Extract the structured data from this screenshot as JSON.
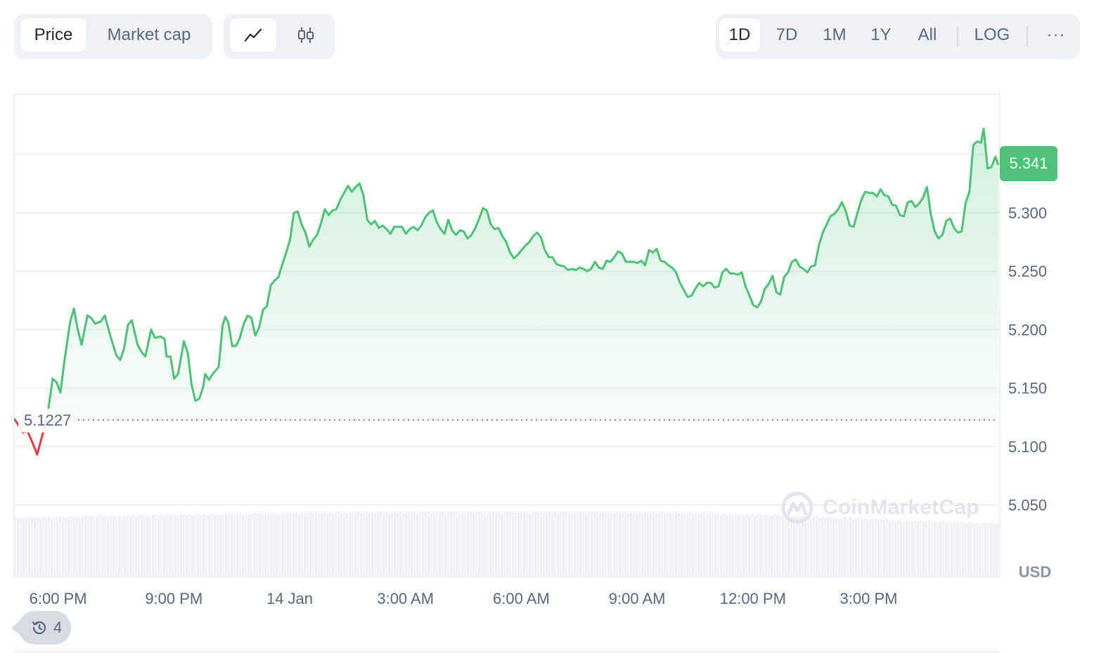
{
  "toolbar": {
    "metric_tabs": [
      "Price",
      "Market cap"
    ],
    "active_metric": "Price",
    "chart_type_icons": [
      "line-chart-icon",
      "candlestick-icon"
    ],
    "active_chart_type": "line-chart-icon",
    "ranges": [
      "1D",
      "7D",
      "1M",
      "1Y",
      "All"
    ],
    "active_range": "1D",
    "log_label": "LOG",
    "more_label": "···"
  },
  "colors": {
    "up": "#4cc276",
    "down": "#ea3943",
    "fill_top": "#d1f0dc",
    "grid": "#eff2f5",
    "volume": "#eff2f5"
  },
  "chart_data": {
    "type": "line",
    "title": "",
    "xlabel": "",
    "ylabel": "",
    "currency": "USD",
    "ylim": [
      5.0,
      5.4
    ],
    "y_ticks": [
      "5.050",
      "5.100",
      "5.150",
      "5.200",
      "5.250",
      "5.300"
    ],
    "x_tick_labels": [
      "6:00 PM",
      "9:00 PM",
      "14 Jan",
      "3:00 AM",
      "6:00 AM",
      "9:00 AM",
      "12:00 PM",
      "3:00 PM"
    ],
    "x_tick_hours": [
      1.14,
      4.14,
      7.14,
      10.14,
      13.14,
      16.14,
      19.14,
      22.14
    ],
    "open_price": 5.1227,
    "current_price": 5.341,
    "current_price_label": "5.341",
    "open_price_label": "5.1227",
    "series": [
      {
        "points": [
          [
            0.0,
            5.124
          ],
          [
            0.1,
            5.119
          ],
          [
            0.22,
            5.112
          ],
          [
            0.35,
            5.113
          ],
          [
            0.48,
            5.103
          ],
          [
            0.6,
            5.093
          ],
          [
            0.72,
            5.108
          ],
          [
            0.85,
            5.123
          ],
          [
            1.0,
            5.158
          ],
          [
            1.1,
            5.155
          ],
          [
            1.2,
            5.146
          ],
          [
            1.3,
            5.172
          ],
          [
            1.45,
            5.206
          ],
          [
            1.55,
            5.218
          ],
          [
            1.65,
            5.2
          ],
          [
            1.75,
            5.187
          ],
          [
            1.9,
            5.212
          ],
          [
            2.0,
            5.21
          ],
          [
            2.1,
            5.205
          ],
          [
            2.25,
            5.207
          ],
          [
            2.35,
            5.212
          ],
          [
            2.5,
            5.194
          ],
          [
            2.65,
            5.178
          ],
          [
            2.75,
            5.174
          ],
          [
            2.85,
            5.184
          ],
          [
            2.95,
            5.204
          ],
          [
            3.05,
            5.208
          ],
          [
            3.2,
            5.187
          ],
          [
            3.3,
            5.181
          ],
          [
            3.4,
            5.177
          ],
          [
            3.55,
            5.2
          ],
          [
            3.65,
            5.193
          ],
          [
            3.8,
            5.194
          ],
          [
            3.9,
            5.192
          ],
          [
            3.95,
            5.177
          ],
          [
            4.05,
            5.177
          ],
          [
            4.15,
            5.158
          ],
          [
            4.25,
            5.162
          ],
          [
            4.4,
            5.19
          ],
          [
            4.5,
            5.18
          ],
          [
            4.6,
            5.153
          ],
          [
            4.7,
            5.139
          ],
          [
            4.8,
            5.141
          ],
          [
            4.9,
            5.151
          ],
          [
            4.95,
            5.162
          ],
          [
            5.05,
            5.157
          ],
          [
            5.15,
            5.162
          ],
          [
            5.3,
            5.168
          ],
          [
            5.4,
            5.203
          ],
          [
            5.47,
            5.211
          ],
          [
            5.55,
            5.206
          ],
          [
            5.65,
            5.186
          ],
          [
            5.75,
            5.186
          ],
          [
            5.85,
            5.193
          ],
          [
            5.95,
            5.205
          ],
          [
            6.05,
            5.212
          ],
          [
            6.15,
            5.21
          ],
          [
            6.25,
            5.195
          ],
          [
            6.35,
            5.202
          ],
          [
            6.45,
            5.217
          ],
          [
            6.55,
            5.22
          ],
          [
            6.65,
            5.238
          ],
          [
            6.75,
            5.242
          ],
          [
            6.85,
            5.245
          ],
          [
            6.95,
            5.256
          ],
          [
            7.05,
            5.266
          ],
          [
            7.15,
            5.277
          ],
          [
            7.25,
            5.3
          ],
          [
            7.35,
            5.301
          ],
          [
            7.45,
            5.29
          ],
          [
            7.55,
            5.283
          ],
          [
            7.65,
            5.271
          ],
          [
            7.75,
            5.277
          ],
          [
            7.85,
            5.281
          ],
          [
            7.95,
            5.291
          ],
          [
            8.05,
            5.303
          ],
          [
            8.15,
            5.298
          ],
          [
            8.25,
            5.302
          ],
          [
            8.35,
            5.303
          ],
          [
            8.45,
            5.311
          ],
          [
            8.55,
            5.317
          ],
          [
            8.65,
            5.323
          ],
          [
            8.75,
            5.318
          ],
          [
            8.85,
            5.322
          ],
          [
            8.95,
            5.325
          ],
          [
            9.05,
            5.315
          ],
          [
            9.15,
            5.294
          ],
          [
            9.25,
            5.29
          ],
          [
            9.35,
            5.293
          ],
          [
            9.45,
            5.287
          ],
          [
            9.55,
            5.289
          ],
          [
            9.65,
            5.286
          ],
          [
            9.75,
            5.282
          ],
          [
            9.85,
            5.288
          ],
          [
            9.95,
            5.288
          ],
          [
            10.05,
            5.288
          ],
          [
            10.15,
            5.282
          ],
          [
            10.25,
            5.286
          ],
          [
            10.35,
            5.288
          ],
          [
            10.45,
            5.285
          ],
          [
            10.55,
            5.289
          ],
          [
            10.65,
            5.296
          ],
          [
            10.75,
            5.3
          ],
          [
            10.85,
            5.302
          ],
          [
            10.95,
            5.292
          ],
          [
            11.05,
            5.286
          ],
          [
            11.15,
            5.282
          ],
          [
            11.25,
            5.294
          ],
          [
            11.35,
            5.285
          ],
          [
            11.45,
            5.281
          ],
          [
            11.55,
            5.285
          ],
          [
            11.65,
            5.284
          ],
          [
            11.75,
            5.278
          ],
          [
            11.85,
            5.281
          ],
          [
            11.95,
            5.287
          ],
          [
            12.05,
            5.295
          ],
          [
            12.15,
            5.304
          ],
          [
            12.25,
            5.302
          ],
          [
            12.35,
            5.29
          ],
          [
            12.45,
            5.286
          ],
          [
            12.55,
            5.287
          ],
          [
            12.65,
            5.28
          ],
          [
            12.75,
            5.275
          ],
          [
            12.85,
            5.266
          ],
          [
            12.95,
            5.261
          ],
          [
            13.05,
            5.264
          ],
          [
            13.15,
            5.268
          ],
          [
            13.25,
            5.272
          ],
          [
            13.35,
            5.275
          ],
          [
            13.45,
            5.28
          ],
          [
            13.55,
            5.283
          ],
          [
            13.65,
            5.279
          ],
          [
            13.75,
            5.268
          ],
          [
            13.85,
            5.262
          ],
          [
            13.95,
            5.262
          ],
          [
            14.05,
            5.256
          ],
          [
            14.15,
            5.255
          ],
          [
            14.25,
            5.254
          ],
          [
            14.35,
            5.251
          ],
          [
            14.45,
            5.252
          ],
          [
            14.55,
            5.251
          ],
          [
            14.65,
            5.253
          ],
          [
            14.75,
            5.252
          ],
          [
            14.85,
            5.25
          ],
          [
            14.95,
            5.252
          ],
          [
            15.05,
            5.258
          ],
          [
            15.15,
            5.253
          ],
          [
            15.25,
            5.252
          ],
          [
            15.35,
            5.259
          ],
          [
            15.45,
            5.258
          ],
          [
            15.55,
            5.262
          ],
          [
            15.65,
            5.267
          ],
          [
            15.75,
            5.265
          ],
          [
            15.85,
            5.258
          ],
          [
            15.95,
            5.258
          ],
          [
            16.05,
            5.258
          ],
          [
            16.15,
            5.257
          ],
          [
            16.25,
            5.259
          ],
          [
            16.35,
            5.255
          ],
          [
            16.45,
            5.268
          ],
          [
            16.55,
            5.266
          ],
          [
            16.65,
            5.269
          ],
          [
            16.75,
            5.259
          ],
          [
            16.85,
            5.258
          ],
          [
            16.95,
            5.255
          ],
          [
            17.05,
            5.253
          ],
          [
            17.15,
            5.249
          ],
          [
            17.25,
            5.24
          ],
          [
            17.35,
            5.234
          ],
          [
            17.45,
            5.228
          ],
          [
            17.55,
            5.229
          ],
          [
            17.65,
            5.235
          ],
          [
            17.75,
            5.24
          ],
          [
            17.85,
            5.237
          ],
          [
            17.95,
            5.24
          ],
          [
            18.05,
            5.24
          ],
          [
            18.15,
            5.236
          ],
          [
            18.25,
            5.237
          ],
          [
            18.35,
            5.249
          ],
          [
            18.45,
            5.252
          ],
          [
            18.55,
            5.248
          ],
          [
            18.65,
            5.248
          ],
          [
            18.75,
            5.247
          ],
          [
            18.85,
            5.249
          ],
          [
            18.95,
            5.237
          ],
          [
            19.05,
            5.229
          ],
          [
            19.15,
            5.221
          ],
          [
            19.25,
            5.219
          ],
          [
            19.35,
            5.224
          ],
          [
            19.45,
            5.235
          ],
          [
            19.55,
            5.239
          ],
          [
            19.65,
            5.246
          ],
          [
            19.75,
            5.232
          ],
          [
            19.85,
            5.23
          ],
          [
            19.95,
            5.245
          ],
          [
            20.05,
            5.249
          ],
          [
            20.15,
            5.258
          ],
          [
            20.25,
            5.26
          ],
          [
            20.35,
            5.254
          ],
          [
            20.45,
            5.252
          ],
          [
            20.55,
            5.249
          ],
          [
            20.65,
            5.254
          ],
          [
            20.75,
            5.255
          ],
          [
            20.85,
            5.272
          ],
          [
            20.95,
            5.283
          ],
          [
            21.05,
            5.29
          ],
          [
            21.15,
            5.297
          ],
          [
            21.25,
            5.299
          ],
          [
            21.35,
            5.303
          ],
          [
            21.45,
            5.309
          ],
          [
            21.55,
            5.301
          ],
          [
            21.65,
            5.289
          ],
          [
            21.75,
            5.288
          ],
          [
            21.85,
            5.3
          ],
          [
            21.95,
            5.311
          ],
          [
            22.05,
            5.318
          ],
          [
            22.15,
            5.317
          ],
          [
            22.25,
            5.317
          ],
          [
            22.35,
            5.314
          ],
          [
            22.45,
            5.32
          ],
          [
            22.55,
            5.315
          ],
          [
            22.65,
            5.314
          ],
          [
            22.75,
            5.307
          ],
          [
            22.85,
            5.306
          ],
          [
            22.95,
            5.298
          ],
          [
            23.05,
            5.297
          ],
          [
            23.15,
            5.309
          ],
          [
            23.25,
            5.31
          ],
          [
            23.35,
            5.305
          ],
          [
            23.45,
            5.308
          ],
          [
            23.55,
            5.313
          ],
          [
            23.65,
            5.322
          ],
          [
            23.75,
            5.299
          ],
          [
            23.85,
            5.284
          ],
          [
            23.95,
            5.278
          ],
          [
            24.05,
            5.281
          ],
          [
            24.15,
            5.293
          ],
          [
            24.25,
            5.295
          ],
          [
            24.35,
            5.287
          ],
          [
            24.45,
            5.283
          ],
          [
            24.55,
            5.284
          ],
          [
            24.65,
            5.308
          ],
          [
            24.75,
            5.318
          ],
          [
            24.85,
            5.358
          ],
          [
            24.95,
            5.361
          ],
          [
            25.05,
            5.36
          ],
          [
            25.12,
            5.372
          ],
          [
            25.22,
            5.338
          ],
          [
            25.32,
            5.339
          ],
          [
            25.42,
            5.348
          ],
          [
            25.5,
            5.341
          ]
        ]
      }
    ]
  }
}
